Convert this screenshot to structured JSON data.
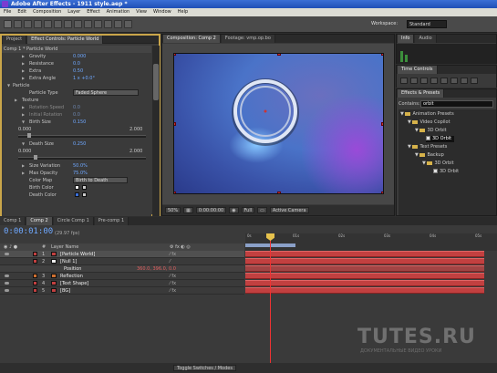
{
  "window": {
    "title": "Adobe After Effects - 1911 style.aep *"
  },
  "menu": [
    "File",
    "Edit",
    "Composition",
    "Layer",
    "Effect",
    "Animation",
    "View",
    "Window",
    "Help"
  ],
  "toolbar": {
    "workspace_label": "Workspace:",
    "workspace_value": "Standard"
  },
  "left_panel": {
    "tabs": [
      "Project",
      "Effect Controls: Particle World"
    ],
    "comp_line": "Comp 1 * Particle World",
    "rows": [
      {
        "label": "Gravity",
        "value": "0.000",
        "indent": 2
      },
      {
        "label": "Resistance",
        "value": "0.0",
        "indent": 2
      },
      {
        "label": "Extra",
        "value": "0.50",
        "indent": 2
      },
      {
        "label": "Extra Angle",
        "value": "1 x +0.0°",
        "indent": 2
      },
      {
        "label": "Particle",
        "value": "",
        "indent": 0,
        "section": true
      },
      {
        "label": "Particle Type",
        "value": "Faded Sphere",
        "indent": 1,
        "dropdown": true
      },
      {
        "label": "Texture",
        "value": "",
        "indent": 1
      },
      {
        "label": "Rotation Speed",
        "value": "0.0",
        "indent": 1
      },
      {
        "label": "Initial Rotation",
        "value": "0.0",
        "indent": 1
      },
      {
        "label": "Birth Size",
        "value": "0.150",
        "indent": 1
      }
    ],
    "birth_slider": {
      "min": "0.000",
      "max": "2.000",
      "position": 0.07
    },
    "rows2": [
      {
        "label": "Death Size",
        "value": "0.250",
        "indent": 1
      }
    ],
    "death_slider": {
      "min": "0.000",
      "max": "2.000",
      "position": 0.12
    },
    "rows3": [
      {
        "label": "Size Variation",
        "value": "50.0%",
        "indent": 1
      },
      {
        "label": "Max Opacity",
        "value": "75.0%",
        "indent": 1
      },
      {
        "label": "Color Map",
        "value": "Birth to Death",
        "indent": 1,
        "dropdown": true
      },
      {
        "label": "Birth Color",
        "value": "",
        "indent": 1,
        "swatch": "#f0f0f0"
      },
      {
        "label": "Death Color",
        "value": "",
        "indent": 1,
        "swatch": "#3a6fd8"
      }
    ]
  },
  "comp_panel": {
    "tabs": [
      "Composition: Comp 2",
      "Footage: vmp.op.bo"
    ],
    "footer": {
      "zoom": "50%",
      "time": "0:00:00:00",
      "res": "Full",
      "camera": "Active Camera"
    }
  },
  "info_panel": {
    "tabs": [
      "Info",
      "Audio"
    ]
  },
  "time_controls": {
    "tabs": [
      "Time Controls"
    ]
  },
  "effects_panel": {
    "tabs": [
      "Effects & Presets"
    ],
    "contains_label": "Contains:",
    "contains_value": "orbit",
    "tree": [
      {
        "label": "Animation Presets",
        "level": 0,
        "type": "folder"
      },
      {
        "label": "Video Copilot",
        "level": 1,
        "type": "folder"
      },
      {
        "label": "3D Orbit",
        "level": 2,
        "type": "folder"
      },
      {
        "label": "3D Orbit",
        "level": 3,
        "type": "preset",
        "selected": true
      },
      {
        "label": "Text Presets",
        "level": 1,
        "type": "folder"
      },
      {
        "label": "Backup",
        "level": 2,
        "type": "folder"
      },
      {
        "label": "3D Orbit",
        "level": 3,
        "type": "folder"
      },
      {
        "label": "3D Orbit",
        "level": 4,
        "type": "preset"
      }
    ]
  },
  "timeline": {
    "tabs": [
      "Comp 1",
      "Comp 2",
      "Circle Comp 1",
      "Pre-comp 1"
    ],
    "timecode": "0:00:01:00",
    "fps": "(29.97 fps)",
    "columns": {
      "num": "#",
      "name": "Layer Name",
      "parent": "Parent"
    },
    "layers": [
      {
        "num": "1",
        "name": "[Particle World]",
        "color": "#c24040",
        "selected": true
      },
      {
        "num": "2",
        "name": "[Null 1]",
        "color": "#c24040"
      },
      {
        "num": "",
        "name": "Position",
        "value": "360.0, 396.0, 0.0",
        "property": true
      },
      {
        "num": "3",
        "name": "Reflection",
        "color": "#d07030"
      },
      {
        "num": "4",
        "name": "[Text Shape]",
        "color": "#c24040"
      },
      {
        "num": "5",
        "name": "[BG]",
        "color": "#c24040"
      }
    ],
    "ruler_ticks": [
      "0s",
      "01s",
      "02s",
      "03s",
      "04s",
      "05s"
    ],
    "footer_button": "Toggle Switches / Modes"
  },
  "watermark": {
    "text": "TUTES.RU",
    "sub": "ДОКУМЕНТАЛЬНЫЕ ВИДЕО УРОКИ"
  }
}
